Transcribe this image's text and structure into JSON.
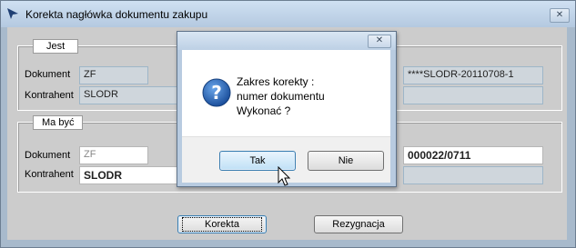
{
  "window": {
    "title": "Korekta nagłówka dokumentu zakupu",
    "close_label": "✕"
  },
  "jest": {
    "label": "Jest",
    "dokument_label": "Dokument",
    "dokument_value": "ZF",
    "kontrahent_label": "Kontrahent",
    "kontrahent_value": "SLODR",
    "number_value": "****SLODR-20110708-1"
  },
  "ma_byc": {
    "label": "Ma być",
    "dokument_label": "Dokument",
    "dokument_value": "ZF",
    "kontrahent_label": "Kontrahent",
    "kontrahent_value": "SLODR",
    "number_value": "000022/0711"
  },
  "buttons": {
    "korekta": "Korekta",
    "rezygnacja": "Rezygnacja"
  },
  "dialog": {
    "close_label": "✕",
    "message_line1": "Zakres korekty :",
    "message_line2": "numer dokumentu",
    "message_line3": "Wykonać ?",
    "tak": "Tak",
    "nie": "Nie"
  }
}
